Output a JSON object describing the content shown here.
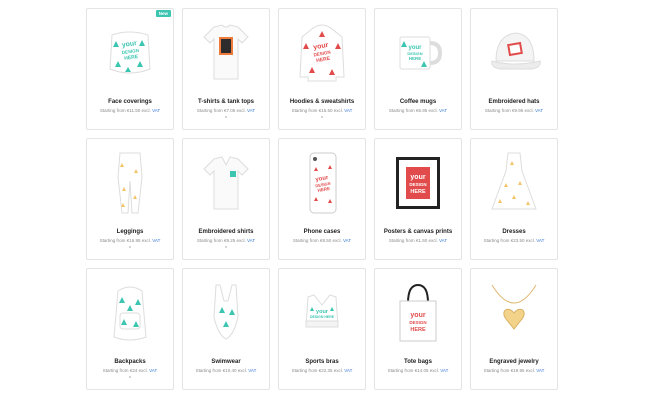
{
  "products": [
    {
      "name": "Face coverings",
      "price_prefix": "Starting from",
      "price": "€11.50 excl.",
      "vat": "VAT",
      "badge": "New",
      "icon": "face-covering-icon"
    },
    {
      "name": "T-shirts & tank tops",
      "price_prefix": "Starting from",
      "price": "€7.05 excl.",
      "vat": "VAT",
      "icon": "tshirt-icon"
    },
    {
      "name": "Hoodies & sweatshirts",
      "price_prefix": "Starting from",
      "price": "€15.50 excl.",
      "vat": "VAT",
      "icon": "hoodie-icon"
    },
    {
      "name": "Coffee mugs",
      "price_prefix": "Starting from",
      "price": "€6.95 excl.",
      "vat": "VAT",
      "icon": "mug-icon"
    },
    {
      "name": "Embroidered hats",
      "price_prefix": "Starting from",
      "price": "€9.95 excl.",
      "vat": "VAT",
      "icon": "hat-icon"
    },
    {
      "name": "Leggings",
      "price_prefix": "Starting from",
      "price": "€16.95 excl.",
      "vat": "VAT",
      "icon": "leggings-icon"
    },
    {
      "name": "Embroidered shirts",
      "price_prefix": "Starting from",
      "price": "€9.25 excl.",
      "vat": "VAT",
      "icon": "polo-shirt-icon"
    },
    {
      "name": "Phone cases",
      "price_prefix": "Starting from",
      "price": "€8.50 excl.",
      "vat": "VAT",
      "icon": "phone-case-icon"
    },
    {
      "name": "Posters & canvas prints",
      "price_prefix": "Starting from",
      "price": "€1.50 excl.",
      "vat": "VAT",
      "icon": "poster-icon"
    },
    {
      "name": "Dresses",
      "price_prefix": "Starting from",
      "price": "€23.50 excl.",
      "vat": "VAT",
      "icon": "dress-icon"
    },
    {
      "name": "Backpacks",
      "price_prefix": "Starting from",
      "price": "€24 excl.",
      "vat": "VAT",
      "icon": "backpack-icon"
    },
    {
      "name": "Swimwear",
      "price_prefix": "Starting from",
      "price": "€10.40 excl.",
      "vat": "VAT",
      "icon": "swimsuit-icon"
    },
    {
      "name": "Sports bras",
      "price_prefix": "Starting from",
      "price": "€22.35 excl.",
      "vat": "VAT",
      "icon": "sports-bra-icon"
    },
    {
      "name": "Tote bags",
      "price_prefix": "Starting from",
      "price": "€14.05 excl.",
      "vat": "VAT",
      "icon": "tote-bag-icon"
    },
    {
      "name": "Engraved jewelry",
      "price_prefix": "Starting from",
      "price": "€18.95 excl.",
      "vat": "VAT",
      "icon": "necklace-icon"
    }
  ],
  "design_text": [
    "your",
    "DESIGN",
    "HERE"
  ],
  "colors": {
    "teal": "#3cc5b0",
    "red": "#e24b4b",
    "orange": "#f07a3a",
    "vat_link": "#3a7bd5",
    "gold": "#f3d28a"
  }
}
